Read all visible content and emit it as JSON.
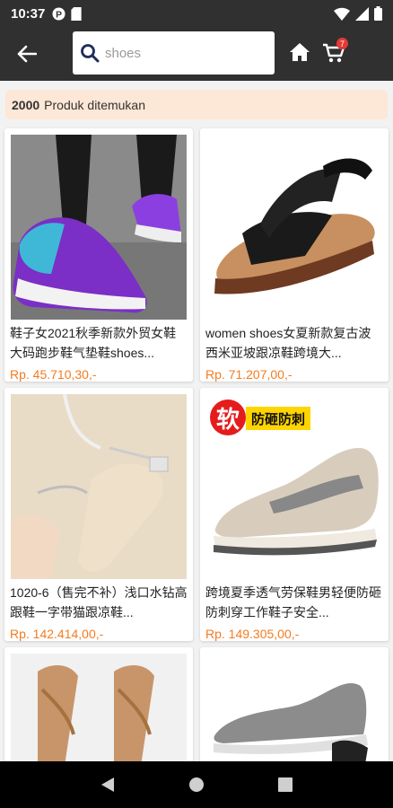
{
  "status_bar": {
    "time": "10:37"
  },
  "search": {
    "placeholder": "shoes"
  },
  "cart": {
    "badge": "7"
  },
  "results": {
    "count": "2000",
    "label": "Produk ditemukan"
  },
  "products": [
    {
      "title": "鞋子女2021秋季新款外贸女鞋大码跑步鞋气垫鞋shoes...",
      "price": "Rp. 45.710,30,-",
      "image": "purple-sneakers"
    },
    {
      "title": "women shoes女夏新款复古波西米亚坡跟凉鞋跨境大...",
      "price": "Rp. 71.207,00,-",
      "image": "black-wedge-sandal"
    },
    {
      "title": "1020-6（售完不补）浅口水钻高跟鞋一字带猫跟凉鞋...",
      "price": "Rp. 142.414,00,-",
      "image": "clear-heel-sandal"
    },
    {
      "title": "跨境夏季透气劳保鞋男轻便防砸防刺穿工作鞋子安全...",
      "price": "Rp. 149.305,00,-",
      "image": "safety-work-shoe",
      "badge_big": "软",
      "badge_text": "防砸防刺"
    },
    {
      "title": "",
      "price": "",
      "image": "strappy-heels"
    },
    {
      "title": "",
      "price": "",
      "image": "grey-knit-sneakers"
    }
  ],
  "colors": {
    "accent": "#f47b20",
    "bar": "#303030",
    "banner": "#fde7d6"
  }
}
